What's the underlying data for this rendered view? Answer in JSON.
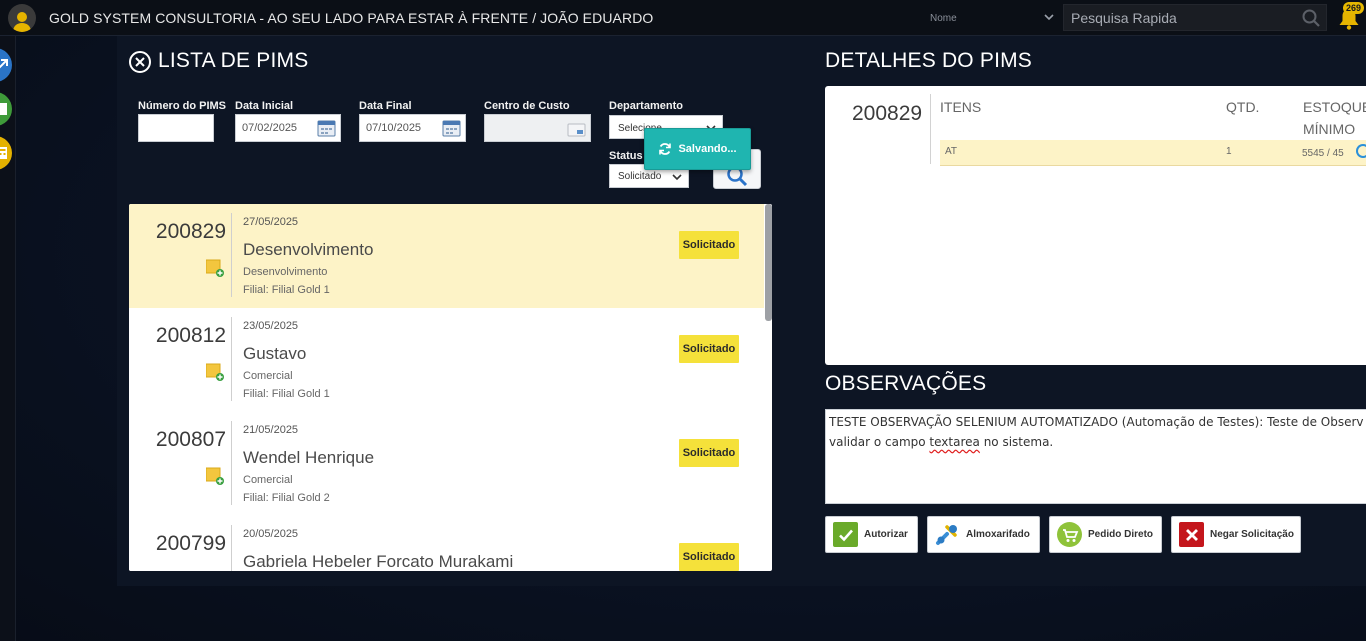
{
  "topbar": {
    "title": "GOLD SYSTEM CONSULTORIA - AO SEU LADO PARA ESTAR À FRENTE / JOÃO EDUARDO",
    "nome_label": "Nome",
    "search_placeholder": "Pesquisa Rapida",
    "notification_count": "269"
  },
  "list_section": {
    "title": "LISTA DE PIMS",
    "filters": {
      "numero_label": "Número do PIMS",
      "numero_value": "",
      "data_inicial_label": "Data Inicial",
      "data_inicial_value": "07/02/2025",
      "data_final_label": "Data Final",
      "data_final_value": "07/10/2025",
      "centro_custo_label": "Centro de Custo",
      "centro_custo_value": "",
      "departamento_label": "Departamento",
      "departamento_value": "Selecione",
      "status_label": "Status",
      "status_value": "Solicitado"
    },
    "saving_toast": "Salvando...",
    "items": [
      {
        "number": "200829",
        "date": "27/05/2025",
        "name": "Desenvolvimento",
        "dept": "Desenvolvimento",
        "filial": "Filial: Filial Gold 1",
        "status": "Solicitado"
      },
      {
        "number": "200812",
        "date": "23/05/2025",
        "name": "Gustavo",
        "dept": "Comercial",
        "filial": "Filial: Filial Gold 1",
        "status": "Solicitado"
      },
      {
        "number": "200807",
        "date": "21/05/2025",
        "name": "Wendel Henrique",
        "dept": "Comercial",
        "filial": "Filial: Filial Gold 2",
        "status": "Solicitado"
      },
      {
        "number": "200799",
        "date": "20/05/2025",
        "name": "Gabriela Hebeler Forcato Murakami",
        "dept": "",
        "filial": "",
        "status": "Solicitado"
      }
    ]
  },
  "details_section": {
    "title": "DETALHES DO PIMS",
    "number": "200829",
    "headers": {
      "itens": "ITENS",
      "qtd": "QTD.",
      "estoque": "ESTOQUE",
      "minimo": "MÍNIMO"
    },
    "row": {
      "item": "AT",
      "qtd": "1",
      "estoque": "5545 / 45"
    }
  },
  "observations": {
    "title": "OBSERVAÇÕES",
    "text_line1": "TESTE OBSERVAÇÃO SELENIUM AUTOMATIZADO (Automação de Testes): Teste de Observ",
    "text_line2_pre": "validar o campo ",
    "text_line2_err": "textarea",
    "text_line2_post": " no sistema."
  },
  "actions": {
    "autorizar": "Autorizar",
    "almoxarifado": "Almoxarifado",
    "pedido_direto": "Pedido Direto",
    "negar": "Negar Solicitação"
  },
  "colors": {
    "selected_row": "#fdf3c7",
    "status_badge": "#f5e13a",
    "toast": "#1fb5b0",
    "panel": "#0d1524"
  }
}
